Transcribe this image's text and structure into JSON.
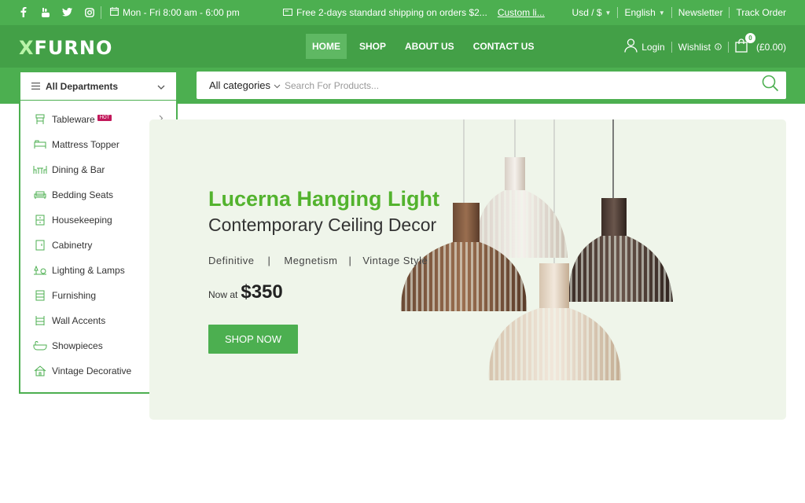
{
  "topbar": {
    "social": [
      "facebook-icon",
      "youtube-icon",
      "twitter-icon",
      "instagram-icon"
    ],
    "hours": "Mon - Fri 8:00 am - 6:00 pm",
    "shipping": "Free 2-days standard shipping on orders $2...",
    "shipping_link": "Custom li...",
    "currency": "Usd / $",
    "language": "English",
    "newsletter": "Newsletter",
    "track": "Track Order"
  },
  "header": {
    "logo": "FURNO",
    "logo_prefix": "X",
    "nav": [
      "HOME",
      "SHOP",
      "ABOUT US",
      "CONTACT US"
    ],
    "login": "Login",
    "wishlist": "Wishlist",
    "cart_count": "0",
    "cart_total": "(£0.00)"
  },
  "departments": {
    "title": "All Departments",
    "hot_badge": "HOT",
    "items": [
      {
        "label": "Tableware",
        "icon": "tableware-icon"
      },
      {
        "label": "Mattress Topper",
        "icon": "mattress-icon"
      },
      {
        "label": "Dining & Bar",
        "icon": "dining-icon"
      },
      {
        "label": "Bedding Seats",
        "icon": "sofa-icon"
      },
      {
        "label": "Housekeeping",
        "icon": "cabinet-icon"
      },
      {
        "label": "Cabinetry",
        "icon": "cabinetry-icon"
      },
      {
        "label": "Lighting & Lamps",
        "icon": "lamp-icon"
      },
      {
        "label": "Furnishing",
        "icon": "furnishing-icon"
      },
      {
        "label": "Wall Accents",
        "icon": "shelf-icon"
      },
      {
        "label": "Showpieces",
        "icon": "bathtub-icon"
      },
      {
        "label": "Vintage Decorative",
        "icon": "house-icon"
      }
    ]
  },
  "search": {
    "category": "All categories",
    "placeholder": "Search For Products..."
  },
  "hero": {
    "title": "Lucerna Hanging Light",
    "subtitle": "Contemporary Ceiling Decor",
    "tags": [
      "Definitive",
      "|",
      "Megnetism",
      "|",
      "Vintage Style"
    ],
    "price_label": "Now at",
    "price": "$350",
    "cta": "SHOP NOW"
  },
  "colors": {
    "primary": "#4caf50",
    "header": "#43a047",
    "hero_bg": "#eff5ea",
    "title_green": "#53b32e",
    "hot": "#c2185b"
  }
}
